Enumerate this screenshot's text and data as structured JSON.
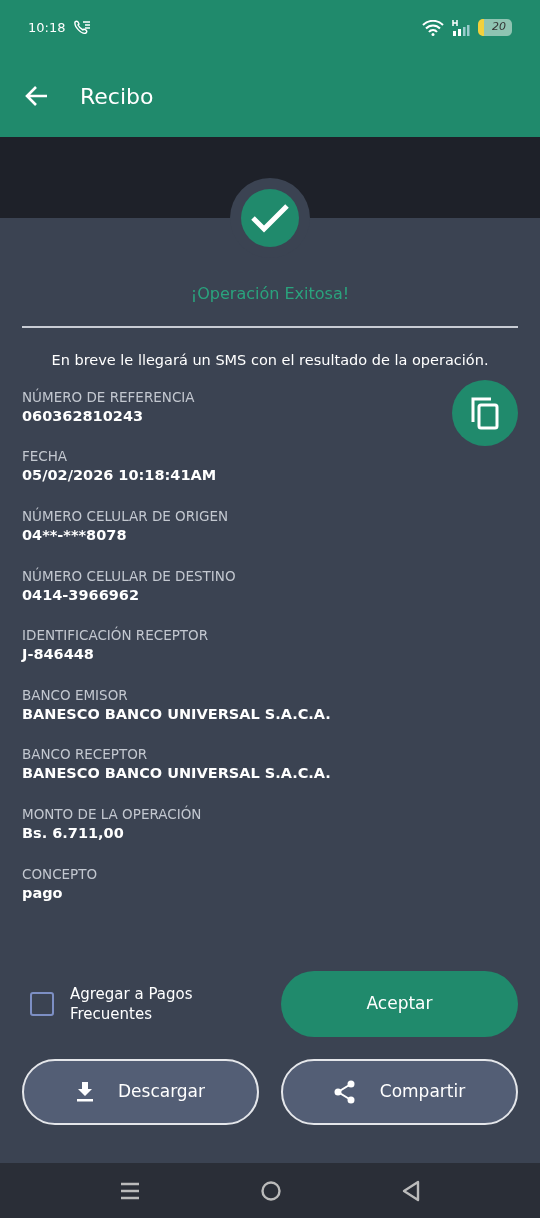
{
  "status_bar": {
    "time": "10:18",
    "battery": "20"
  },
  "app_bar": {
    "title": "Recibo"
  },
  "result": {
    "title": "¡Operación Exitosa!",
    "message": "En breve le llegará un SMS con el resultado de la operación."
  },
  "fields": [
    {
      "label": "NÚMERO DE REFERENCIA",
      "value": "060362810243"
    },
    {
      "label": "FECHA",
      "value": "05/02/2026 10:18:41AM"
    },
    {
      "label": "NÚMERO CELULAR DE ORIGEN",
      "value": "04**-***8078"
    },
    {
      "label": "NÚMERO CELULAR DE DESTINO",
      "value": "0414-3966962"
    },
    {
      "label": "IDENTIFICACIÓN RECEPTOR",
      "value": "J-846448"
    },
    {
      "label": "BANCO EMISOR",
      "value": "BANESCO BANCO UNIVERSAL S.A.C.A."
    },
    {
      "label": "BANCO RECEPTOR",
      "value": "BANESCO BANCO UNIVERSAL S.A.C.A."
    },
    {
      "label": "MONTO DE LA OPERACIÓN",
      "value": "Bs. 6.711,00"
    },
    {
      "label": "CONCEPTO",
      "value": "pago"
    }
  ],
  "frequent_checkbox": {
    "label": "Agregar a Pagos Frecuentes",
    "checked": false
  },
  "buttons": [
    {
      "kind": "primary",
      "label": "Aceptar"
    },
    {
      "kind": "download",
      "label": "Descargar"
    },
    {
      "kind": "share",
      "label": "Compartir"
    }
  ]
}
